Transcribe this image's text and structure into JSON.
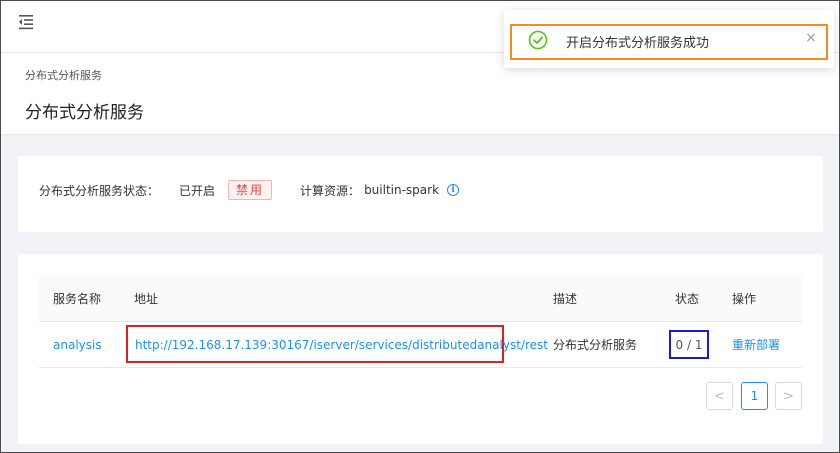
{
  "header": {
    "menu_icon": "menu-fold-icon"
  },
  "toast": {
    "icon": "check-circle-icon",
    "message": "开启分布式分析服务成功",
    "close_icon": "close-icon",
    "close_glyph": "×",
    "accent_color": "#52c41a"
  },
  "page": {
    "breadcrumb": "分布式分析服务",
    "title": "分布式分析服务"
  },
  "status": {
    "label": "分布式分析服务状态：",
    "value": "已开启",
    "disable_button": "禁用",
    "resource_label": "计算资源：",
    "resource_value": "builtin-spark",
    "info_icon": "info-circle-icon",
    "info_glyph": "i"
  },
  "table": {
    "columns": [
      "服务名称",
      "地址",
      "描述",
      "状态",
      "操作"
    ],
    "rows": [
      {
        "name": "analysis",
        "address": "http://192.168.17.139:30167/iserver/services/distributedanalyst/rest",
        "description": "分布式分析服务",
        "state": "0 / 1",
        "action": "重新部署"
      }
    ]
  },
  "pagination": {
    "prev_glyph": "<",
    "current_page": "1",
    "next_glyph": ">"
  },
  "colors": {
    "link": "#1890ff",
    "danger": "#e14848",
    "highlight_red": "#e02020",
    "highlight_blue": "#1a1adb",
    "highlight_orange": "#f28d1b"
  }
}
